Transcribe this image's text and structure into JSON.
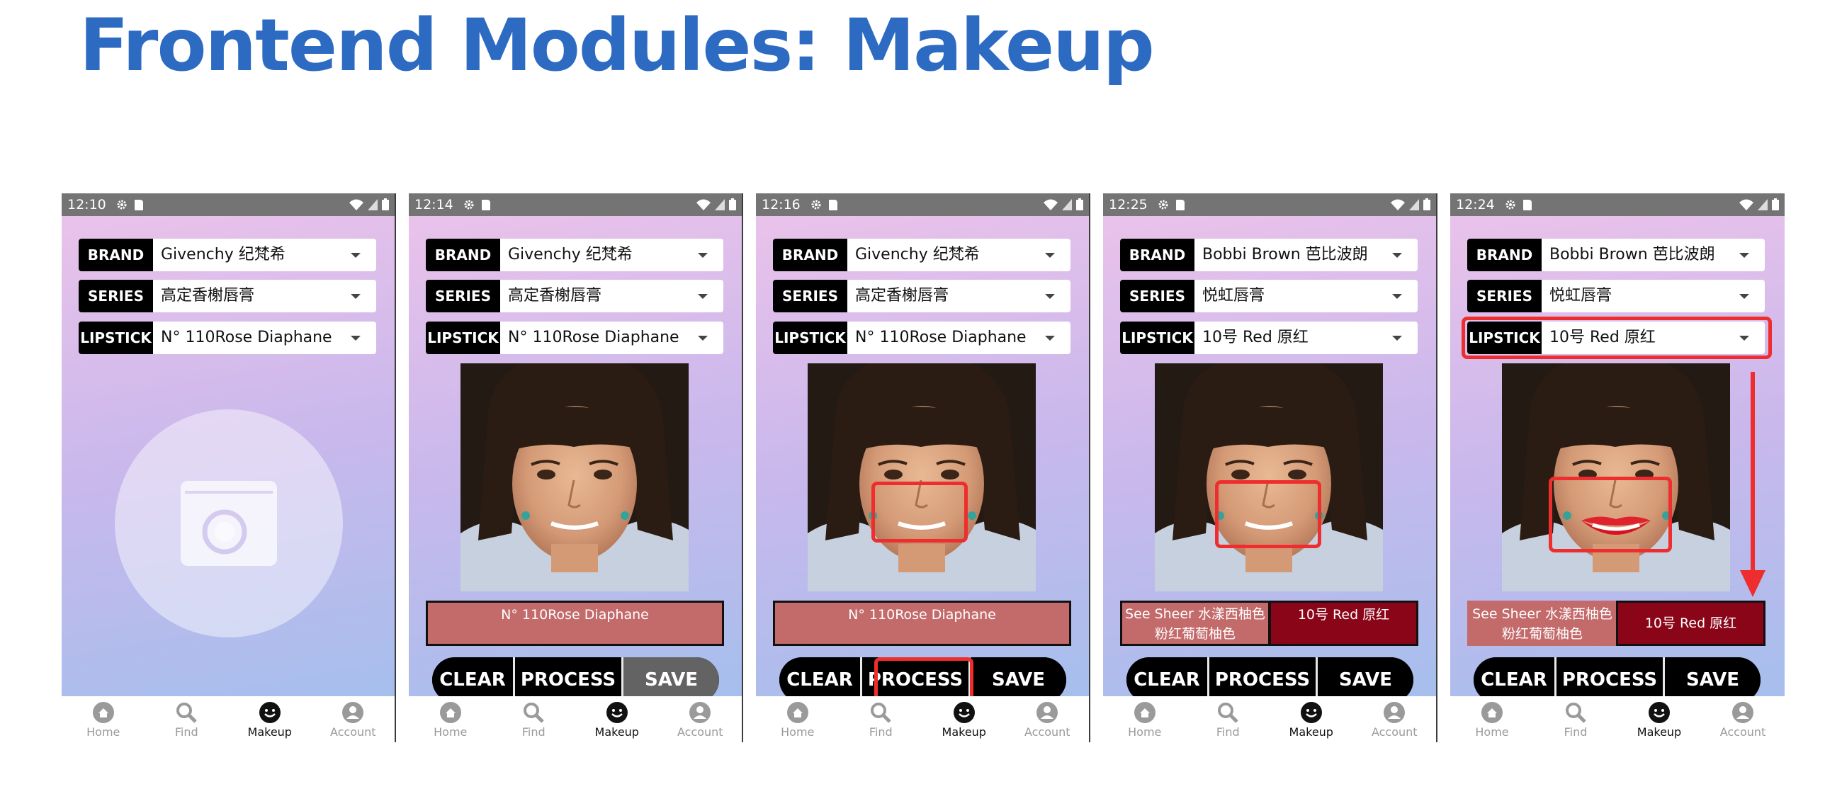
{
  "slide": {
    "title": "Frontend Modules: Makeup"
  },
  "labels": {
    "brand": "BRAND",
    "series": "SERIES",
    "lipstick": "LIPSTICK"
  },
  "buttons": {
    "clear": "CLEAR",
    "process": "PROCESS",
    "save": "SAVE"
  },
  "nav": {
    "home": "Home",
    "find": "Find",
    "makeup": "Makeup",
    "account": "Account"
  },
  "colors": {
    "title": "#2d6bc2",
    "highlight": "#ee2e2e",
    "shade_pink": "#c36a6b",
    "shade_red": "#8a0518"
  },
  "icons": [
    "gear-icon",
    "sdcard-icon",
    "wifi-icon",
    "signal-icon",
    "battery-icon",
    "photo-upload-icon",
    "home-icon",
    "search-icon",
    "smiley-icon",
    "account-icon",
    "arrow-down-icon"
  ],
  "screens": [
    {
      "time": "12:10",
      "brand": "Givenchy 纪梵希",
      "series": "高定香榭唇膏",
      "lipstick": "N° 110Rose Diaphane"
    },
    {
      "time": "12:14",
      "brand": "Givenchy 纪梵希",
      "series": "高定香榭唇膏",
      "lipstick": "N° 110Rose Diaphane",
      "shade": "N° 110Rose Diaphane"
    },
    {
      "time": "12:16",
      "brand": "Givenchy 纪梵希",
      "series": "高定香榭唇膏",
      "lipstick": "N° 110Rose Diaphane",
      "shade": "N° 110Rose Diaphane"
    },
    {
      "time": "12:25",
      "brand": "Bobbi Brown 芭比波朗",
      "series": "悦虹唇膏",
      "lipstick": "10号 Red 原红",
      "shade_a_line1": "See Sheer 水漾西柚色",
      "shade_a_line2": "粉红葡萄柚色",
      "shade_b": "10号 Red 原红"
    },
    {
      "time": "12:24",
      "brand": "Bobbi Brown 芭比波朗",
      "series": "悦虹唇膏",
      "lipstick": "10号 Red 原红",
      "shade_a_line1": "See Sheer 水漾西柚色",
      "shade_a_line2": "粉红葡萄柚色",
      "shade_b": "10号 Red 原红"
    }
  ]
}
